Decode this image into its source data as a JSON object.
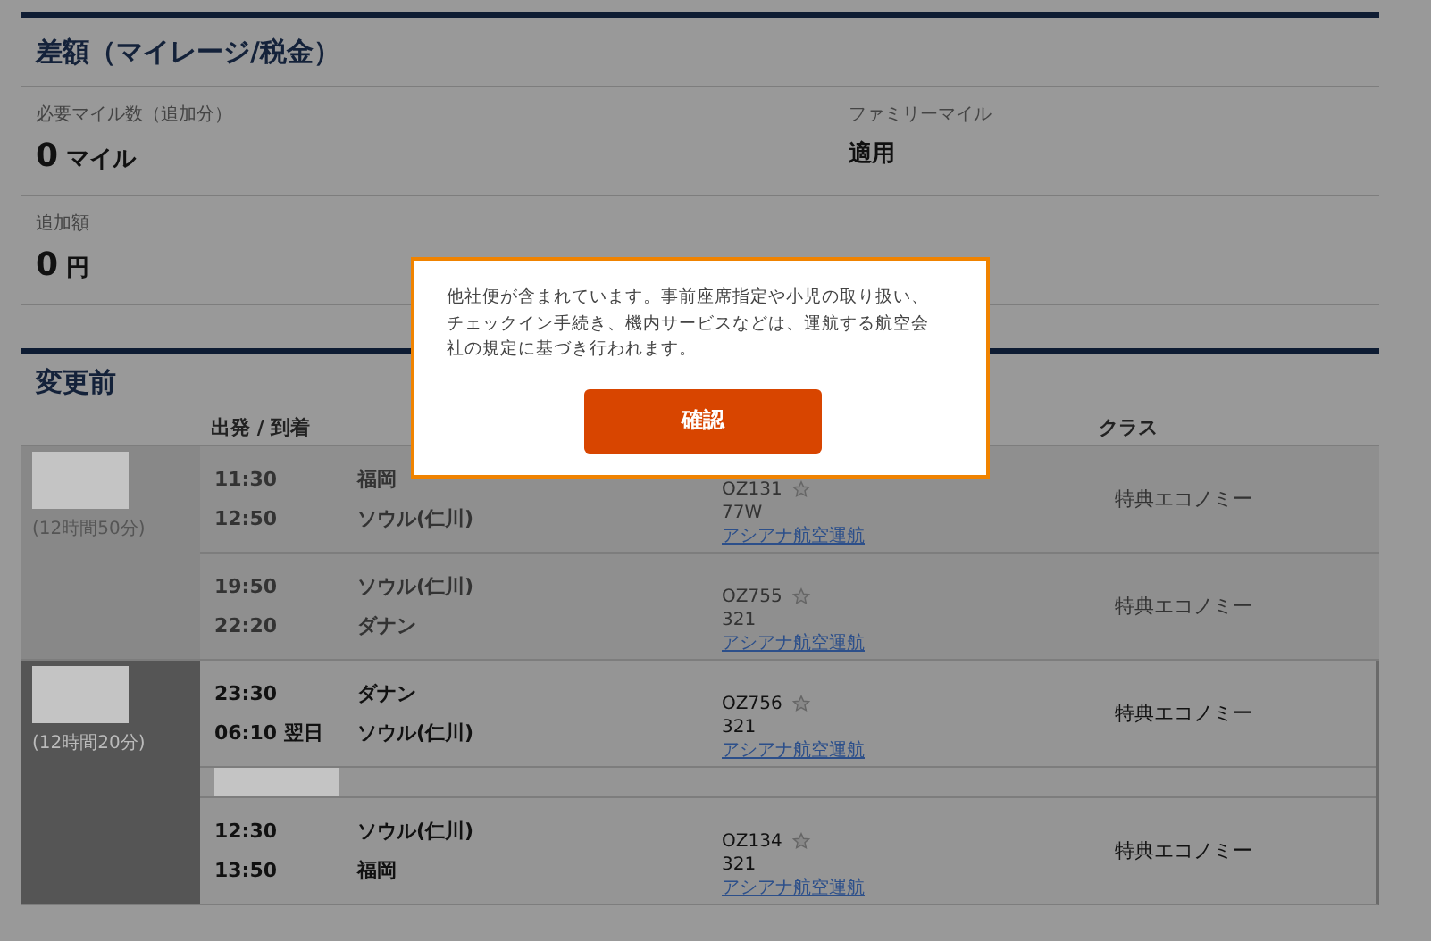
{
  "summary": {
    "title": "差額（マイレージ/税金）",
    "fields": [
      {
        "label": "必要マイル数（追加分）",
        "amount": "0",
        "unit": "マイル"
      },
      {
        "label": "ファミリーマイル",
        "value": "適用"
      },
      {
        "label": "追加額",
        "amount": "0",
        "unit": "円"
      }
    ]
  },
  "before": {
    "title": "変更前",
    "columns": [
      "出発 / 到着",
      "クラス"
    ],
    "groups": [
      {
        "duration": "(12時間50分)",
        "selected": false,
        "connection": false,
        "segments": [
          {
            "dep_time": "11:30",
            "dep_city": "福岡",
            "arr_time": "12:50",
            "arr_city": "ソウル(仁川)",
            "flight": "OZ131",
            "aircraft": "77W",
            "operator": "アシアナ航空運航",
            "class": "特典エコノミー"
          },
          {
            "dep_time": "19:50",
            "dep_city": "ソウル(仁川)",
            "arr_time": "22:20",
            "arr_city": "ダナン",
            "flight": "OZ755",
            "aircraft": "321",
            "operator": "アシアナ航空運航",
            "class": "特典エコノミー"
          }
        ]
      },
      {
        "duration": "(12時間20分)",
        "selected": true,
        "connection": true,
        "segments": [
          {
            "dep_time": "23:30",
            "dep_city": "ダナン",
            "arr_time": "06:10 翌日",
            "arr_city": "ソウル(仁川)",
            "flight": "OZ756",
            "aircraft": "321",
            "operator": "アシアナ航空運航",
            "class": "特典エコノミー"
          },
          {
            "dep_time": "12:30",
            "dep_city": "ソウル(仁川)",
            "arr_time": "13:50",
            "arr_city": "福岡",
            "flight": "OZ134",
            "aircraft": "321",
            "operator": "アシアナ航空運航",
            "class": "特典エコノミー"
          }
        ]
      }
    ]
  },
  "dialog": {
    "message": "他社便が含まれています。事前座席指定や小児の取り扱い、チェックイン手続き、機内サービスなどは、運航する航空会社の規定に基づき行われます。",
    "button": "確認"
  }
}
